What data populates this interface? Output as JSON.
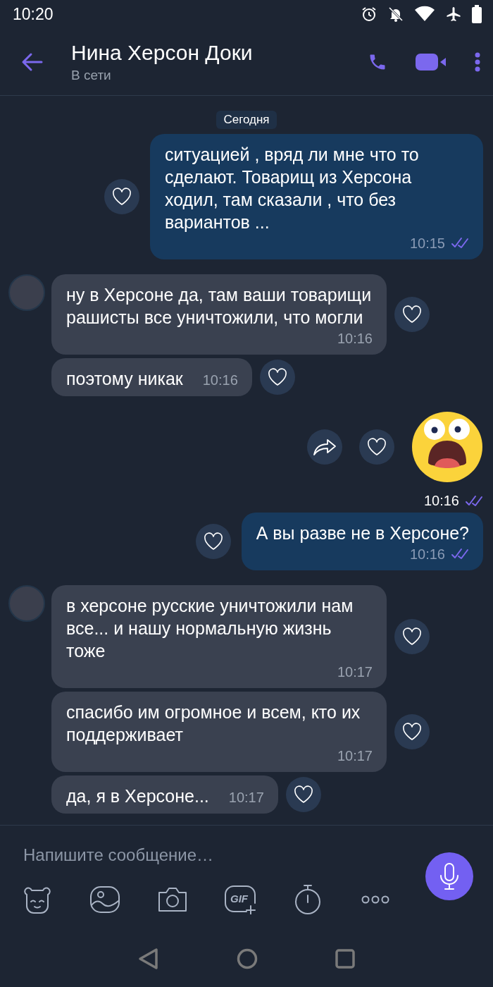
{
  "status_bar": {
    "time": "10:20"
  },
  "header": {
    "title": "Нина Херсон Доки",
    "subtitle": "В сети"
  },
  "date_chip": "Сегодня",
  "messages": [
    {
      "kind": "outgoing",
      "text": "ситуацией , вряд ли мне что то сделают. Товарищ из Херсона ходил, там сказали , что без вариантов ...",
      "time": "10:15",
      "read": true
    },
    {
      "kind": "incoming",
      "avatar": true,
      "text": "ну в Херсоне да, там ваши товарищи рашисты все уничтожили, что могли",
      "time": "10:16"
    },
    {
      "kind": "incoming",
      "avatar": false,
      "text": "поэтому никак",
      "time": "10:16"
    },
    {
      "kind": "sticker",
      "time": "10:16",
      "read": true
    },
    {
      "kind": "outgoing",
      "text": "А вы разве не в Херсоне?",
      "time": "10:16",
      "read": true
    },
    {
      "kind": "incoming",
      "avatar": true,
      "text": "в херсоне русские уничтожили нам все... и нашу нормальную жизнь тоже",
      "time": "10:17"
    },
    {
      "kind": "incoming",
      "avatar": false,
      "text": "спасибо им огромное и всем, кто их поддерживает",
      "time": "10:17"
    },
    {
      "kind": "incoming",
      "avatar": false,
      "text": "да, я в Херсоне...",
      "time": "10:17"
    }
  ],
  "composer": {
    "placeholder": "Напишите сообщение…",
    "gif_label": "GIF"
  }
}
